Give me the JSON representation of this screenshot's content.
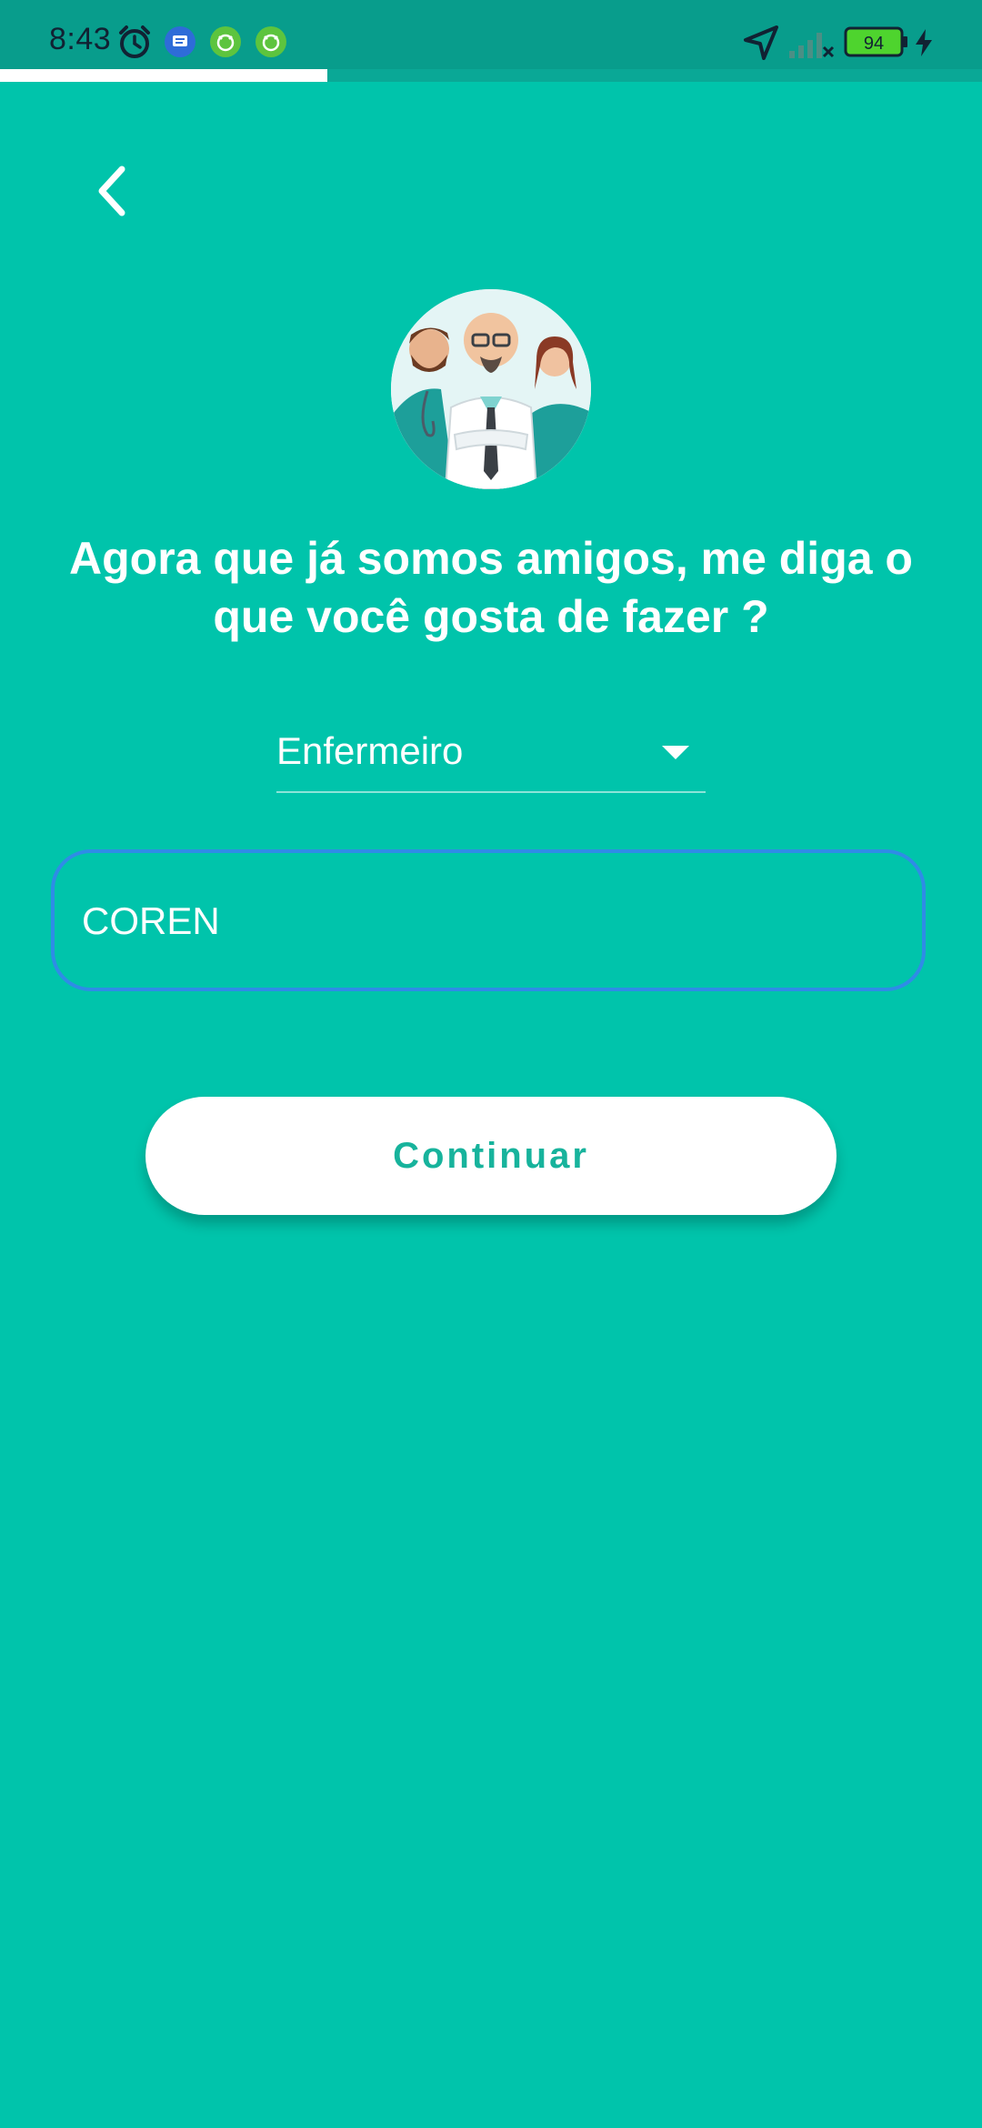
{
  "status_bar": {
    "time": "8:43",
    "battery_level": "94",
    "icons": [
      "alarm-icon",
      "message-icon",
      "app-notification-icon",
      "app-notification-icon",
      "location-arrow-icon",
      "signal-icon",
      "battery-icon",
      "charging-icon"
    ]
  },
  "progress": {
    "fraction": 0.333
  },
  "back": {
    "icon": "chevron-left-icon"
  },
  "headline": {
    "text": "Agora que já somos amigos, me diga o que você gosta de fazer ?"
  },
  "profession_select": {
    "selected": "Enfermeiro"
  },
  "registration_field": {
    "placeholder": "COREN",
    "value": ""
  },
  "continue_button": {
    "label": "Continuar"
  },
  "colors": {
    "background": "#00C4AB",
    "accent": "#17B39C",
    "field_border": "#2F8CE6"
  }
}
